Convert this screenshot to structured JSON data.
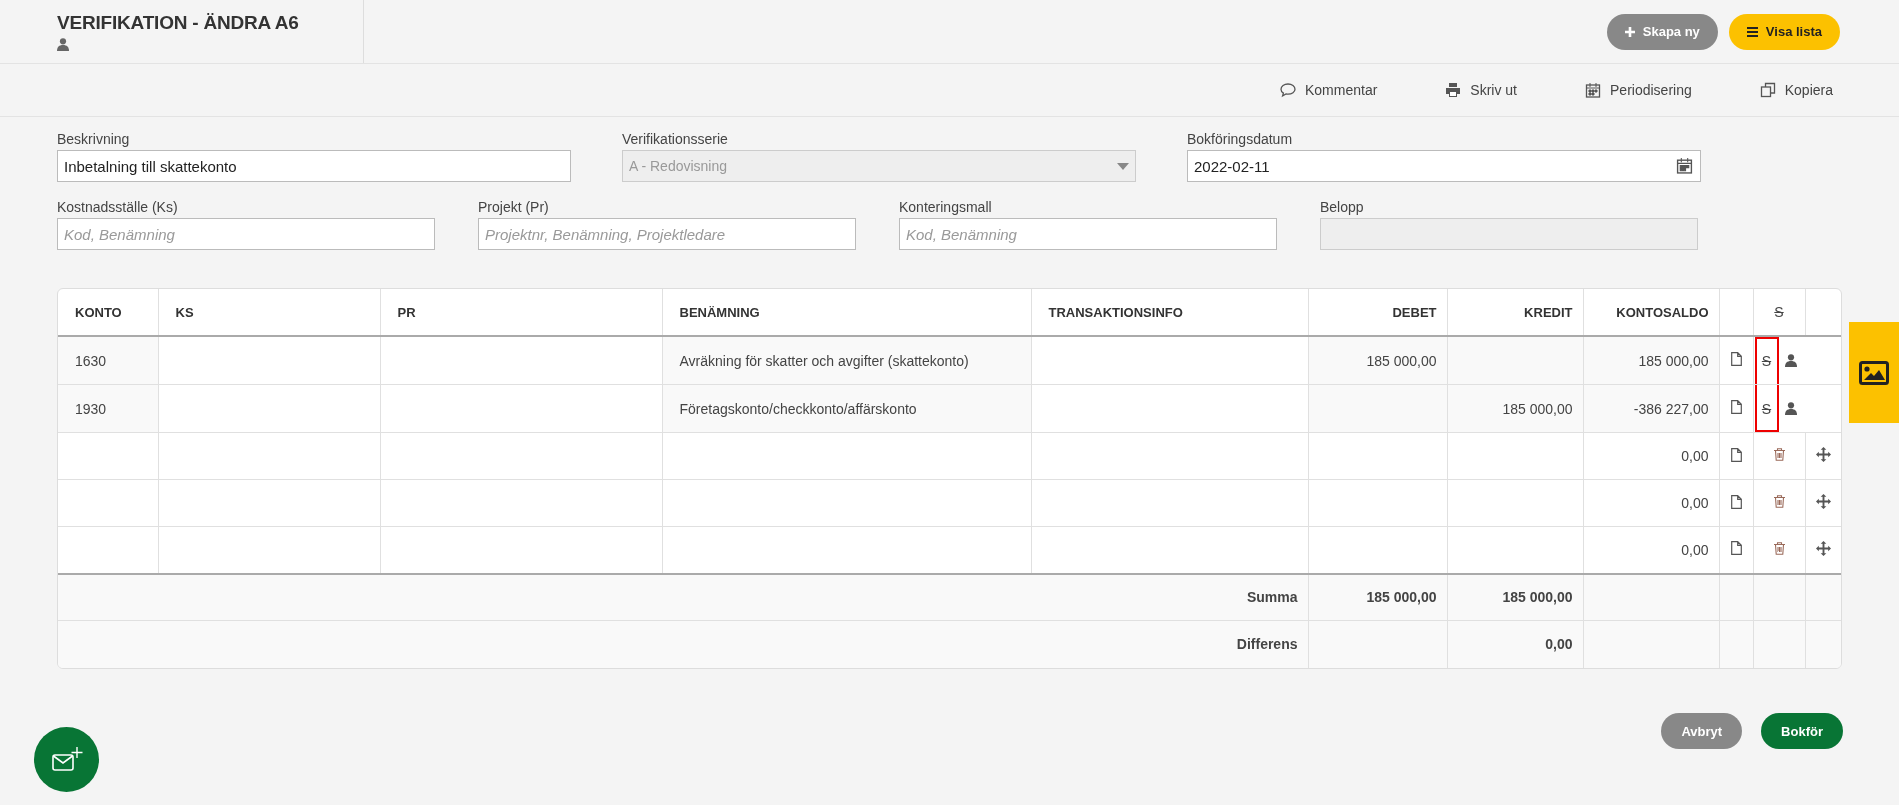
{
  "header": {
    "title": "VERIFIKATION - ÄNDRA A6",
    "buttons": [
      {
        "label": "Skapa ny",
        "kind": "secondary"
      },
      {
        "label": "Visa lista",
        "kind": "primary"
      }
    ]
  },
  "toolbar": [
    {
      "label": "Kommentar",
      "kind": "comment"
    },
    {
      "label": "Skriv ut",
      "kind": "print"
    },
    {
      "label": "Periodisering",
      "kind": "calendar"
    },
    {
      "label": "Kopiera",
      "kind": "copy"
    }
  ],
  "form": {
    "rows": [
      [
        {
          "label": "Beskrivning",
          "kind": "text",
          "value": "Inbetalning till skattekonto",
          "disabled": false
        },
        {
          "label": "Verifikationsserie",
          "kind": "select",
          "value": "A - Redovisning",
          "disabled": true
        },
        {
          "label": "Bokföringsdatum",
          "kind": "date",
          "value": "2022-02-11",
          "disabled": false
        }
      ],
      [
        {
          "label": "Kostnadsställe (Ks)",
          "kind": "text",
          "placeholder": "Kod, Benämning",
          "disabled": false
        },
        {
          "label": "Projekt (Pr)",
          "kind": "text",
          "placeholder": "Projektnr, Benämning, Projektledare",
          "disabled": false
        },
        {
          "label": "Konteringsmall",
          "kind": "text",
          "placeholder": "Kod, Benämning",
          "disabled": false
        },
        {
          "label": "Belopp",
          "kind": "text",
          "disabled": true
        }
      ]
    ]
  },
  "table": {
    "columns": [
      "KONTO",
      "KS",
      "PR",
      "BENÄMNING",
      "TRANSAKTIONSINFO",
      "DEBET",
      "KREDIT",
      "KONTOSALDO",
      "",
      "S",
      ""
    ],
    "rows": [
      {
        "kind": "booked",
        "highlighted": true,
        "strike_icon": "S",
        "konto": "1630",
        "benamning": "Avräkning för skatter och avgifter (skattekonto)",
        "debet": "185 000,00",
        "kontosaldo": "185 000,00"
      },
      {
        "kind": "booked",
        "highlighted": true,
        "strike_icon": "S",
        "konto": "1930",
        "benamning": "Företagskonto/checkkonto/affärskonto",
        "kredit": "185 000,00",
        "kontosaldo": "-386 227,00"
      },
      {
        "kind": "empty",
        "highlighted": false,
        "kontosaldo": "0,00"
      },
      {
        "kind": "empty",
        "highlighted": false,
        "kontosaldo": "0,00"
      },
      {
        "kind": "empty",
        "highlighted": false,
        "kontosaldo": "0,00"
      }
    ],
    "footer": [
      {
        "label": "Summa",
        "debet": "185 000,00",
        "kredit": "185 000,00"
      },
      {
        "label": "Differens",
        "kredit": "0,00"
      }
    ]
  },
  "actions": [
    {
      "label": "Avbryt",
      "kind": "secondary"
    },
    {
      "label": "Bokför",
      "kind": "primary"
    }
  ]
}
